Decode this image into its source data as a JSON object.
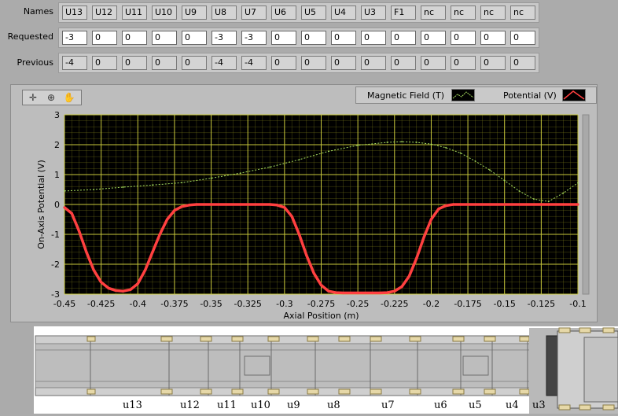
{
  "array": {
    "names_label": "Names",
    "requested_label": "Requested",
    "previous_label": "Previous",
    "names": [
      "U13",
      "U12",
      "U11",
      "U10",
      "U9",
      "U8",
      "U7",
      "U6",
      "U5",
      "U4",
      "U3",
      "F1",
      "nc",
      "nc",
      "nc",
      "nc"
    ],
    "requested": [
      "-3",
      "0",
      "0",
      "0",
      "0",
      "-3",
      "-3",
      "0",
      "0",
      "0",
      "0",
      "0",
      "0",
      "0",
      "0",
      "0"
    ],
    "previous": [
      "-4",
      "0",
      "0",
      "0",
      "0",
      "-4",
      "-4",
      "0",
      "0",
      "0",
      "0",
      "0",
      "0",
      "0",
      "0",
      "0"
    ]
  },
  "legend": {
    "series1": "Magnetic Field (T)",
    "series2": "Potential (V)"
  },
  "palette": {
    "tools": [
      "cursor-icon",
      "zoom-icon",
      "pan-icon"
    ]
  },
  "chart_data": {
    "type": "line",
    "xlabel": "Axial Position (m)",
    "ylabel": "On-Axis Potential (V)",
    "xlim": [
      -0.45,
      -0.1
    ],
    "ylim": [
      -3,
      3
    ],
    "x_ticks": [
      "-0.45",
      "-0.425",
      "-0.4",
      "-0.375",
      "-0.35",
      "-0.325",
      "-0.3",
      "-0.275",
      "-0.25",
      "-0.225",
      "-0.2",
      "-0.175",
      "-0.15",
      "-0.125",
      "-0.1"
    ],
    "y_ticks": [
      "3",
      "2",
      "1",
      "0",
      "-1",
      "-2",
      "-3"
    ],
    "grid": true,
    "colors": {
      "plot_bg": "#000000",
      "grid": "#8c8c1e",
      "potential": "#ff4040",
      "field": "#a8e060"
    },
    "series": [
      {
        "name": "Potential (V)",
        "x": [
          -0.45,
          -0.445,
          -0.44,
          -0.435,
          -0.43,
          -0.425,
          -0.42,
          -0.415,
          -0.41,
          -0.405,
          -0.4,
          -0.395,
          -0.39,
          -0.385,
          -0.38,
          -0.375,
          -0.37,
          -0.365,
          -0.36,
          -0.355,
          -0.35,
          -0.34,
          -0.33,
          -0.32,
          -0.31,
          -0.305,
          -0.3,
          -0.295,
          -0.29,
          -0.285,
          -0.28,
          -0.275,
          -0.27,
          -0.265,
          -0.26,
          -0.25,
          -0.24,
          -0.235,
          -0.23,
          -0.225,
          -0.22,
          -0.215,
          -0.21,
          -0.205,
          -0.2,
          -0.195,
          -0.19,
          -0.185,
          -0.18,
          -0.17,
          -0.16,
          -0.15,
          -0.14,
          -0.13,
          -0.12,
          -0.11,
          -0.1
        ],
        "y": [
          -0.1,
          -0.3,
          -0.9,
          -1.6,
          -2.2,
          -2.6,
          -2.8,
          -2.88,
          -2.9,
          -2.85,
          -2.65,
          -2.2,
          -1.6,
          -1.0,
          -0.5,
          -0.2,
          -0.07,
          -0.02,
          0,
          0,
          0,
          0,
          0,
          0,
          0,
          -0.02,
          -0.1,
          -0.4,
          -1.0,
          -1.7,
          -2.3,
          -2.7,
          -2.9,
          -2.95,
          -2.96,
          -2.96,
          -2.96,
          -2.96,
          -2.95,
          -2.9,
          -2.75,
          -2.4,
          -1.8,
          -1.1,
          -0.5,
          -0.15,
          -0.04,
          0,
          0,
          0,
          0,
          0,
          0,
          0,
          0,
          0,
          0
        ]
      },
      {
        "name": "Magnetic Field (T)",
        "x": [
          -0.45,
          -0.43,
          -0.41,
          -0.39,
          -0.37,
          -0.35,
          -0.33,
          -0.31,
          -0.29,
          -0.27,
          -0.25,
          -0.23,
          -0.22,
          -0.21,
          -0.2,
          -0.19,
          -0.18,
          -0.17,
          -0.16,
          -0.15,
          -0.14,
          -0.13,
          -0.12,
          -0.11,
          -0.1
        ],
        "y": [
          0.45,
          0.5,
          0.58,
          0.65,
          0.73,
          0.88,
          1.05,
          1.25,
          1.5,
          1.78,
          1.98,
          2.08,
          2.1,
          2.08,
          2.02,
          1.9,
          1.72,
          1.45,
          1.15,
          0.8,
          0.45,
          0.18,
          0.1,
          0.38,
          0.72
        ]
      }
    ]
  },
  "schematic": {
    "labels": [
      "u13",
      "u12",
      "u11",
      "u10",
      "u9",
      "u8",
      "u7",
      "u6",
      "u5",
      "u4",
      "u3"
    ]
  }
}
